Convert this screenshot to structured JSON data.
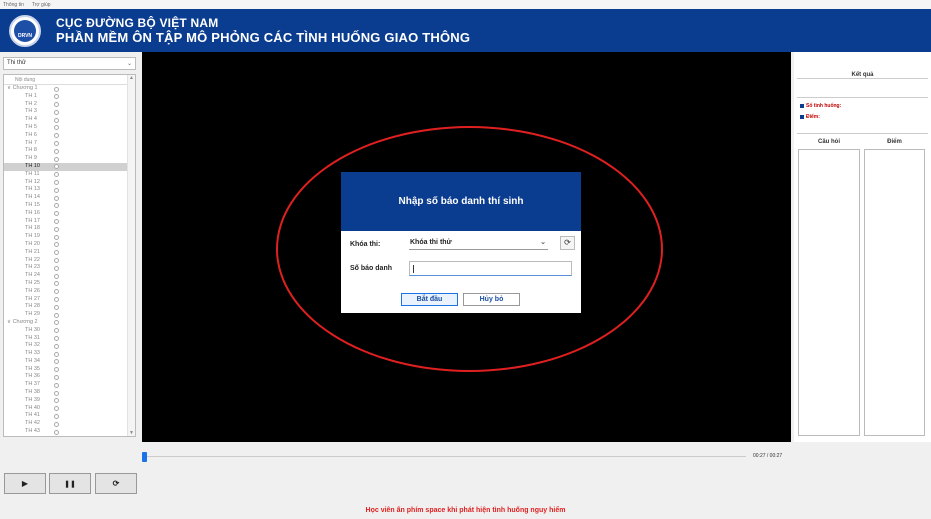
{
  "menu": {
    "items": [
      "Thông tin",
      "Trợ giúp"
    ]
  },
  "header": {
    "logo_text": "DRVN",
    "title_line1": "CỤC ĐƯỜNG BỘ VIỆT NAM",
    "title_line2": "PHẦN MỀM ÔN TẬP MÔ PHỎNG CÁC TÌNH HUỐNG GIAO THÔNG"
  },
  "sidebar": {
    "mode_select": "Thi thử",
    "column_header": "Nội dung",
    "chapter1": "Chương 1",
    "chapter2": "Chương 2",
    "selected_item": "TH 10",
    "chapter1_items": [
      "TH 1",
      "TH 2",
      "TH 3",
      "TH 4",
      "TH 5",
      "TH 6",
      "TH 7",
      "TH 8",
      "TH 9",
      "TH 10",
      "TH 11",
      "TH 12",
      "TH 13",
      "TH 14",
      "TH 15",
      "TH 16",
      "TH 17",
      "TH 18",
      "TH 19",
      "TH 20",
      "TH 21",
      "TH 22",
      "TH 23",
      "TH 24",
      "TH 25",
      "TH 26",
      "TH 27",
      "TH 28",
      "TH 29"
    ],
    "chapter2_items": [
      "TH 30",
      "TH 31",
      "TH 32",
      "TH 33",
      "TH 34",
      "TH 35",
      "TH 36",
      "TH 37",
      "TH 38",
      "TH 39",
      "TH 40",
      "TH 41",
      "TH 42",
      "TH 43"
    ]
  },
  "dialog": {
    "title": "Nhập số báo danh thí sinh",
    "course_label": "Khóa thi:",
    "course_value": "Khóa thi thử",
    "id_label": "Số báo danh",
    "id_value": "",
    "start_button": "Bắt đầu",
    "cancel_button": "Hủy bỏ"
  },
  "results": {
    "title": "Kết quả",
    "situations_label": "Số tình huống:",
    "score_label": "Điểm:",
    "col_question": "Câu hỏi",
    "col_score": "Điểm"
  },
  "player": {
    "time": "00:27 / 00:27",
    "progress": 0,
    "play_icon": "play-icon",
    "pause_icon": "pause-icon",
    "replay_icon": "replay-icon"
  },
  "notice": "Học viên ấn phím space khi phát hiện tình huống nguy hiểm",
  "colors": {
    "header_blue": "#0a3c8f",
    "alert_red": "#e02020",
    "accent_blue": "#1a73e8"
  }
}
